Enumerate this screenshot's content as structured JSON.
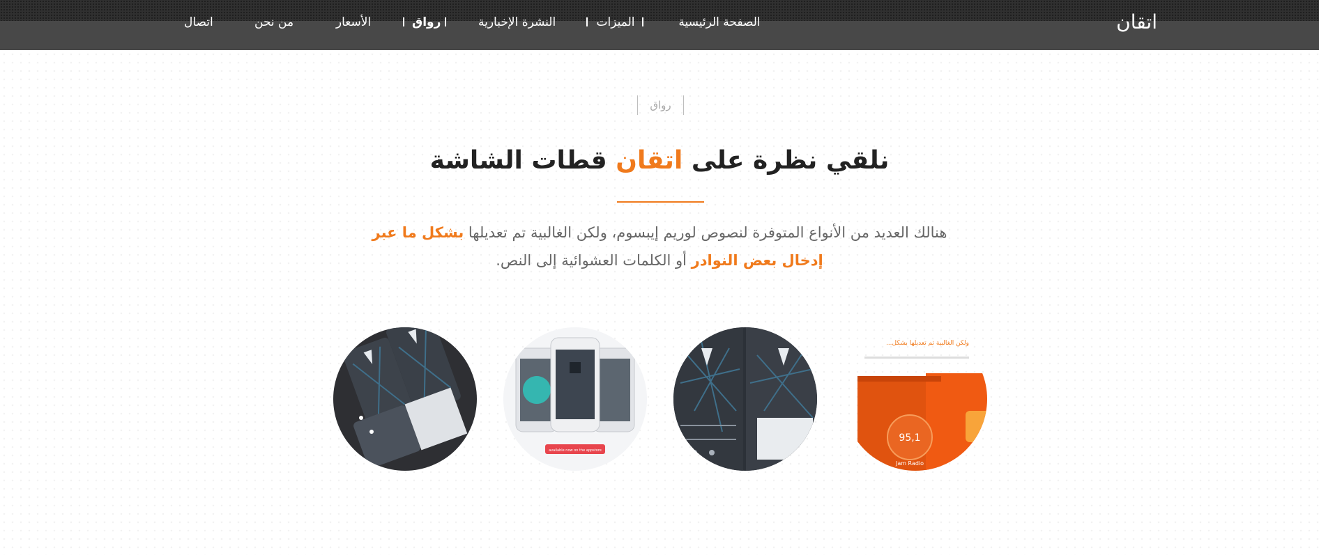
{
  "header": {
    "logo": "اتقان",
    "nav": [
      {
        "label": "الصفحة الرئيسية"
      },
      {
        "label": "الميزات"
      },
      {
        "label": "النشرة الإخبارية"
      },
      {
        "label": "رواق",
        "active": true
      },
      {
        "label": "الأسعار"
      },
      {
        "label": "من نحن"
      },
      {
        "label": "اتصال"
      }
    ]
  },
  "section": {
    "label": "رواق",
    "title_part1": "نلقي نظرة على ",
    "title_accent": "اتقان",
    "title_part2": " قطات الشاشة",
    "desc_part1": "هنالك العديد من الأنواع المتوفرة لنصوص لوريم إيبسوم، ولكن الغالبية تم تعديلها ",
    "desc_hl1": "بشكل ما عبر",
    "desc_hl2": "إدخال بعض النوادر",
    "desc_part2": " أو الكلمات العشوائية إلى النص."
  },
  "screenshots": [
    {
      "icon": "orange-radio-app-screenshot",
      "snippet_text": "...ولكن الغالبية تم تعديلها بشكل",
      "radio_value": "95,1",
      "radio_label": "Jam Radio"
    },
    {
      "icon": "dark-phones-screenshot"
    },
    {
      "icon": "white-iphones-screenshot",
      "badge": "available now on the appstore"
    },
    {
      "icon": "dark-app-screens-screenshot"
    }
  ],
  "colors": {
    "accent": "#f07a1c",
    "header_bg": "#484848",
    "text_dark": "#222222",
    "text_body": "#666666"
  }
}
